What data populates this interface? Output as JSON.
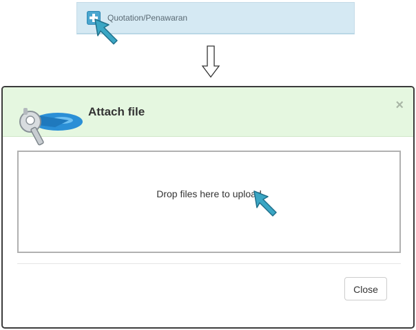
{
  "top_bar": {
    "label": "Quotation/Penawaran",
    "icon": "plus-icon",
    "accent": "#4aa6cf"
  },
  "flow_arrow": {
    "icon": "arrow-down-icon"
  },
  "dialog": {
    "title": "Attach file",
    "close_glyph": "×",
    "dropzone_text": "Drop files here to upload",
    "close_button_label": "Close",
    "header_color": "#e5f7e0"
  },
  "cursor": {
    "icon": "pointer-cursor-icon",
    "color": "#3aa6c4"
  }
}
